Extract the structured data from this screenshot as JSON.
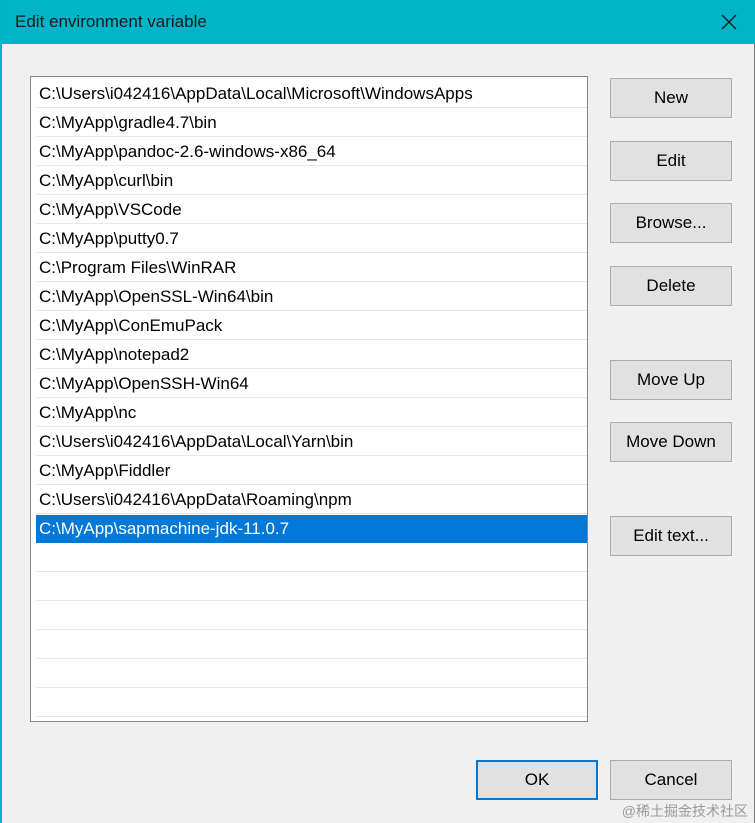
{
  "window": {
    "title": "Edit environment variable",
    "close_icon": "close-icon"
  },
  "path_list": {
    "entries": [
      "C:\\Users\\i042416\\AppData\\Local\\Microsoft\\WindowsApps",
      "C:\\MyApp\\gradle4.7\\bin",
      "C:\\MyApp\\pandoc-2.6-windows-x86_64",
      "C:\\MyApp\\curl\\bin",
      "C:\\MyApp\\VSCode",
      "C:\\MyApp\\putty0.7",
      "C:\\Program Files\\WinRAR",
      "C:\\MyApp\\OpenSSL-Win64\\bin",
      "C:\\MyApp\\ConEmuPack",
      "C:\\MyApp\\notepad2",
      "C:\\MyApp\\OpenSSH-Win64",
      "C:\\MyApp\\nc",
      "C:\\Users\\i042416\\AppData\\Local\\Yarn\\bin",
      "C:\\MyApp\\Fiddler",
      "C:\\Users\\i042416\\AppData\\Roaming\\npm",
      "C:\\MyApp\\sapmachine-jdk-11.0.7"
    ],
    "selected_entry": "C:\\MyApp\\sapmachine-jdk-11.0.7"
  },
  "buttons": {
    "new": "New",
    "edit": "Edit",
    "browse": "Browse...",
    "delete": "Delete",
    "move_up": "Move Up",
    "move_down": "Move Down",
    "edit_text": "Edit text...",
    "ok": "OK",
    "cancel": "Cancel"
  },
  "watermark": "@稀土掘金技术社区",
  "colors": {
    "titlebar": "#00b4c8",
    "selection": "#0078d7",
    "default_button_border": "#0078d7"
  }
}
